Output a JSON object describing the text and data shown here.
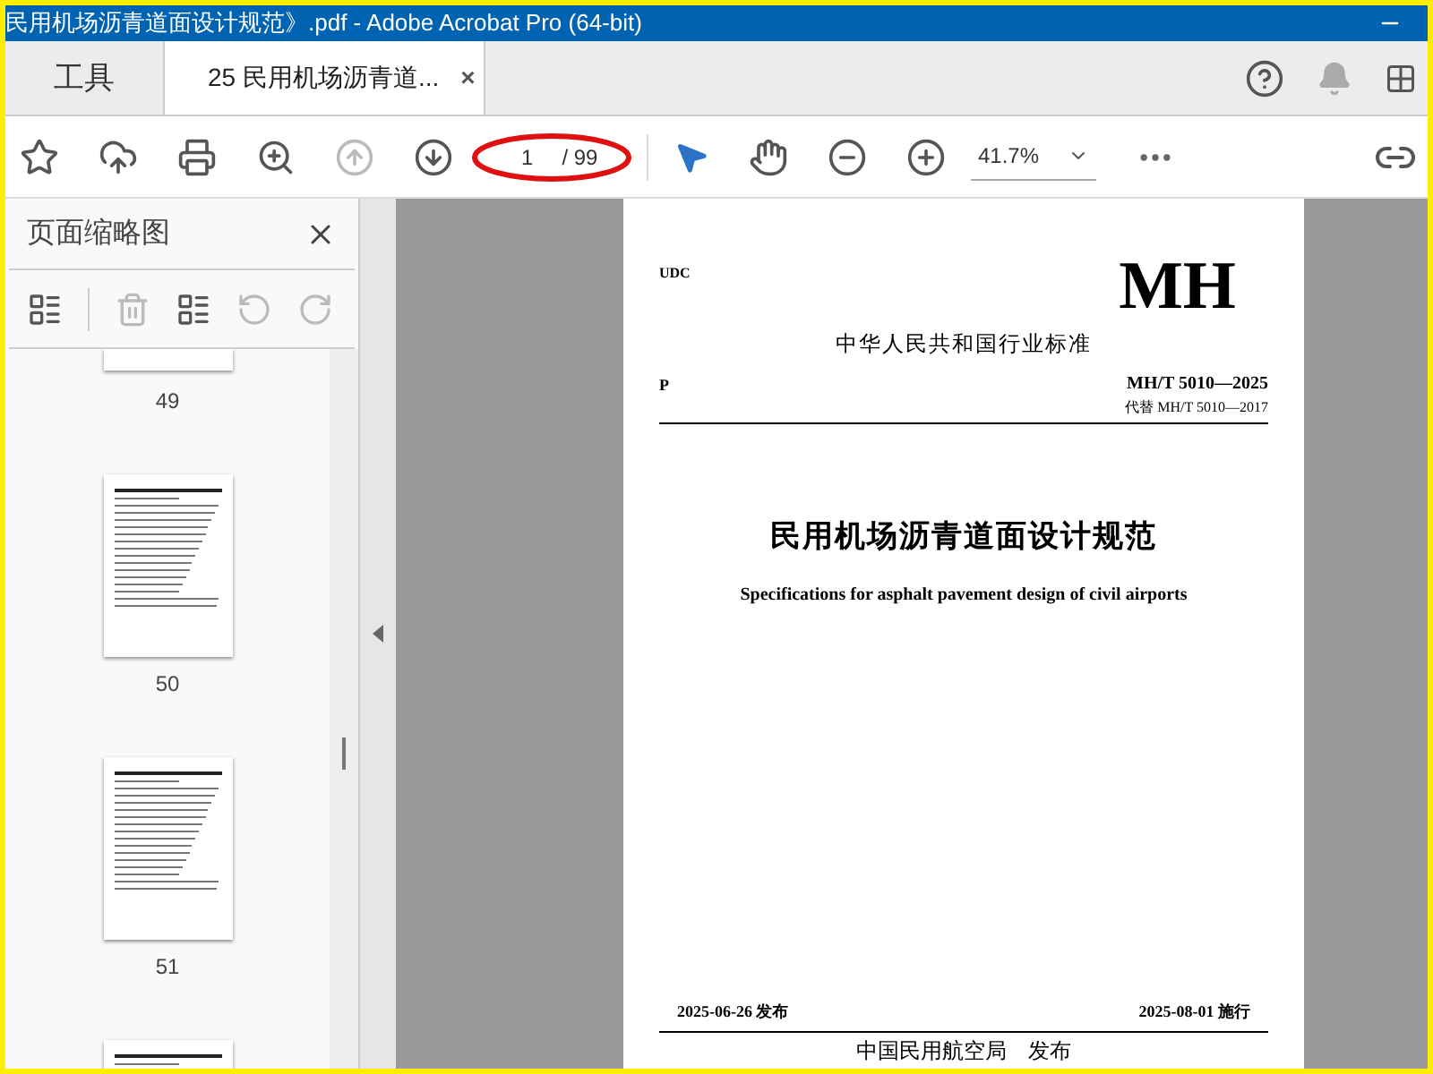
{
  "window": {
    "title": "民用机场沥青道面设计规范》.pdf - Adobe Acrobat Pro (64-bit)"
  },
  "tabs": [
    {
      "label": "工具",
      "selected": false
    },
    {
      "label": "25 民用机场沥青道...",
      "selected": true,
      "close": "×"
    }
  ],
  "toolbar": {
    "previous_page": {
      "disabled": true
    },
    "next_page": {
      "disabled": false
    },
    "page_number": "1",
    "page_total": "/ 99",
    "zoom": "41.7%"
  },
  "sidebar": {
    "title": "页面缩略图",
    "delete": {
      "disabled": true
    },
    "undo": {
      "disabled": true
    },
    "thumbnails": [
      {
        "label": "49",
        "kind": "cut"
      },
      {
        "label": "50",
        "kind": "full"
      },
      {
        "label": "51",
        "kind": "full"
      },
      {
        "kind": "partial"
      }
    ]
  },
  "document": {
    "udc": "UDC",
    "code_big": "MH",
    "standard_type": "中华人民共和国行业标准",
    "class_mark": "P",
    "number": "MH/T 5010—2025",
    "replaces": "代替 MH/T 5010—2017",
    "title": "民用机场沥青道面设计规范",
    "title_en": "Specifications for asphalt pavement design of civil airports",
    "issued": "2025-06-26 发布",
    "effective": "2025-08-01 施行",
    "issuer": "中国民用航空局　发布"
  }
}
